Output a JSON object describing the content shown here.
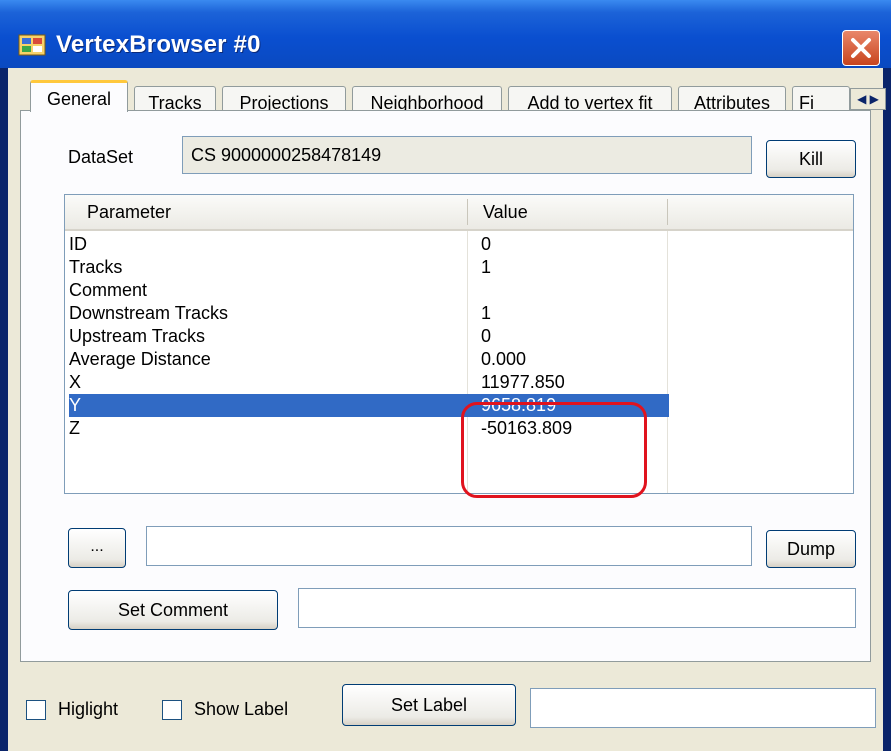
{
  "window": {
    "title": "VertexBrowser #0"
  },
  "tabs": [
    {
      "label": "General"
    },
    {
      "label": "Tracks"
    },
    {
      "label": "Projections"
    },
    {
      "label": "Neighborhood"
    },
    {
      "label": "Add to vertex fit"
    },
    {
      "label": "Attributes"
    },
    {
      "label": "Fi"
    }
  ],
  "general": {
    "dataset_label": "DataSet",
    "dataset_value": "CS 9000000258478149",
    "kill_button": "Kill",
    "table": {
      "headers": [
        "Parameter",
        "Value"
      ],
      "rows": [
        {
          "parameter": "ID",
          "value": "0"
        },
        {
          "parameter": "Tracks",
          "value": "1"
        },
        {
          "parameter": "Comment",
          "value": ""
        },
        {
          "parameter": "Downstream Tracks",
          "value": "1"
        },
        {
          "parameter": "Upstream Tracks",
          "value": "0"
        },
        {
          "parameter": "Average Distance",
          "value": "0.000"
        },
        {
          "parameter": "X",
          "value": "11977.850"
        },
        {
          "parameter": "Y",
          "value": "9658.819"
        },
        {
          "parameter": "Z",
          "value": "-50163.809"
        }
      ],
      "selected_row": "Y"
    },
    "browse_button": "...",
    "path_value": "",
    "dump_button": "Dump",
    "set_comment_button": "Set Comment",
    "comment_value": ""
  },
  "bottom": {
    "highlight_label": "Higlight",
    "highlight_checked": false,
    "show_label_label": "Show Label",
    "show_label_checked": false,
    "set_label_button": "Set Label",
    "label_value": ""
  },
  "colors": {
    "titlebar": "#0a4fd0",
    "selection": "#316ac5",
    "annotation_ring": "#e0131e"
  }
}
